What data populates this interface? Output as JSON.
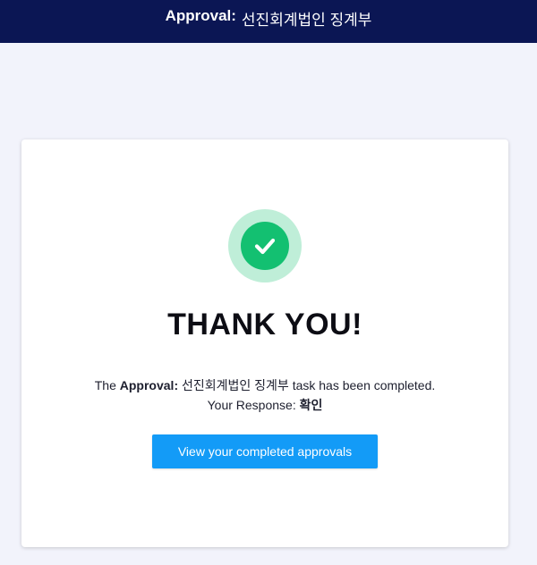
{
  "header": {
    "prefix": "Approval:",
    "name": "선진회계법인 징계부"
  },
  "card": {
    "heading": "THANK YOU!",
    "message": {
      "lead": "The",
      "approval_label": "Approval:",
      "approval_name": "선진회계법인 징계부",
      "tail": "task has been completed."
    },
    "response": {
      "label": "Your Response:",
      "value": "확인"
    },
    "button_label": "View your completed approvals",
    "icon": "check-circle-icon"
  },
  "colors": {
    "header_bg": "#0b1654",
    "page_bg": "#f2f3fb",
    "success_green": "#13c071",
    "success_halo": "#bfeed8",
    "button_blue": "#139bf7"
  }
}
